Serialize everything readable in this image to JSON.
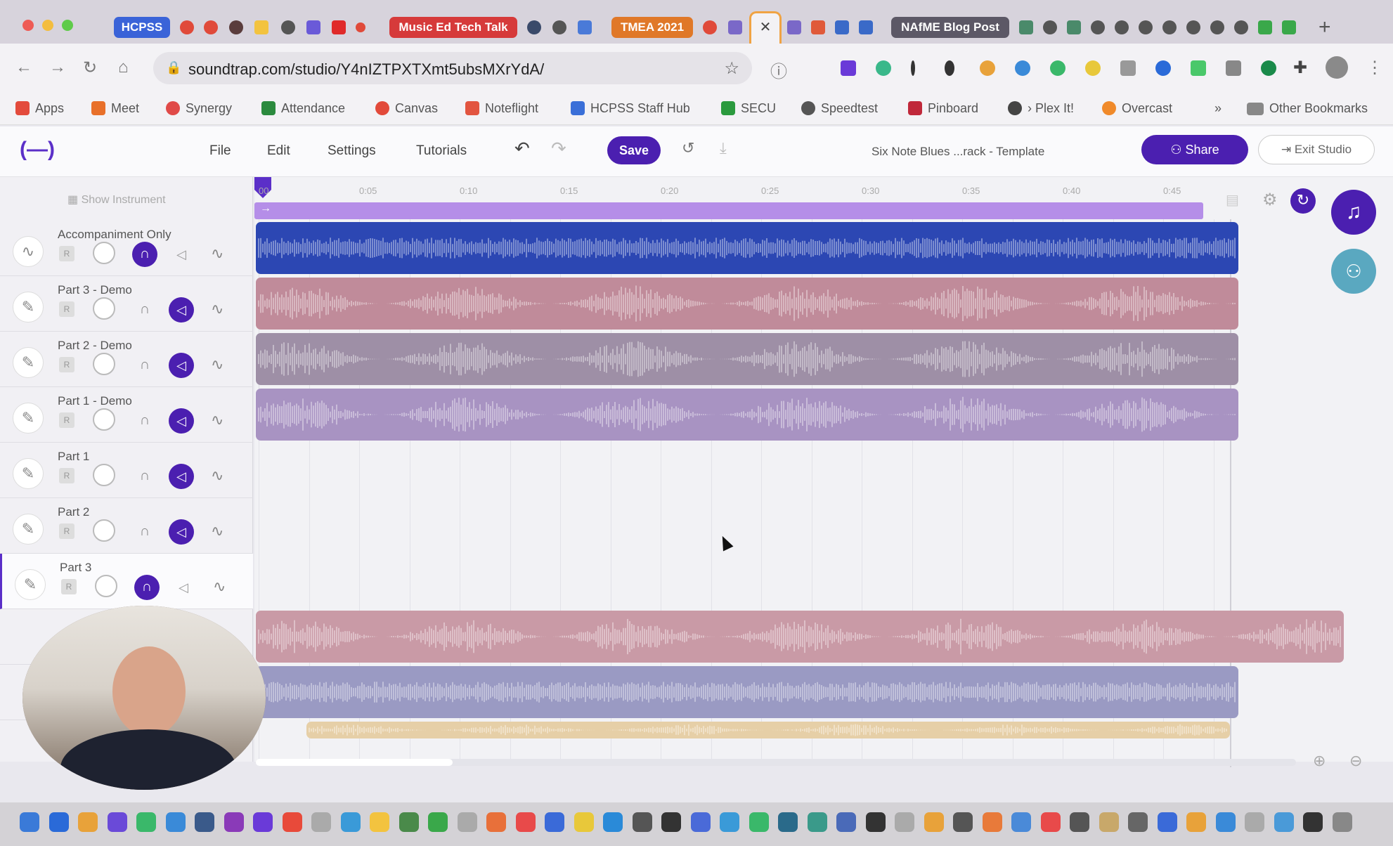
{
  "browser": {
    "tab_groups": [
      {
        "label": "HCPSS",
        "color": "#3a63d8"
      },
      {
        "label": "Music Ed Tech Talk",
        "color": "#d63a3a"
      },
      {
        "label": "TMEA 2021",
        "color": "#e07828"
      },
      {
        "label": "NAfME Blog Post",
        "color": "#5c5866"
      }
    ],
    "active_tab_close": "✕",
    "new_tab": "+",
    "url": "soundtrap.com/studio/Y4nIZTPXTXmt5ubsMXrYdA/"
  },
  "bookmarks": [
    {
      "label": "Apps",
      "color": "#e34b3c"
    },
    {
      "label": "Meet",
      "color": "#e8702a"
    },
    {
      "label": "Synergy",
      "color": "#e04a48"
    },
    {
      "label": "Attendance",
      "color": "#2b8a3e"
    },
    {
      "label": "Canvas",
      "color": "#e24a3a"
    },
    {
      "label": "Noteflight",
      "color": "#e25540"
    },
    {
      "label": "HCPSS Staff Hub",
      "color": "#3a6fd8"
    },
    {
      "label": "SECU",
      "color": "#2b9a3e"
    },
    {
      "label": "Speedtest",
      "color": "#555555"
    },
    {
      "label": "Pinboard",
      "color": "#c0283a"
    },
    {
      "label": "› Plex It!",
      "color": "#444444"
    },
    {
      "label": "Overcast",
      "color": "#f08a2a"
    },
    {
      "label": "»",
      "color": ""
    },
    {
      "label": "Other Bookmarks",
      "color": "#777777"
    }
  ],
  "app": {
    "logo": "(—)",
    "menu": [
      "File",
      "Edit",
      "Settings",
      "Tutorials"
    ],
    "save": "Save",
    "project_title": "Six Note Blues ...rack - Template",
    "share": "Share",
    "exit": "Exit Studio"
  },
  "studio": {
    "show_instrument": "Show Instrument",
    "time_ticks": [
      "00",
      "0:05",
      "0:10",
      "0:15",
      "0:20",
      "0:25",
      "0:30",
      "0:35",
      "0:40",
      "0:45"
    ],
    "tracks": [
      {
        "name": "Accompaniment Only",
        "icon": "waveform-icon",
        "solo_active": true,
        "mute_active": false,
        "clip_color": "#2c47b3",
        "clip": true
      },
      {
        "name": "Part 3 - Demo",
        "icon": "mic-icon",
        "solo_active": false,
        "mute_active": true,
        "clip_color": "#c08b9a",
        "clip": true
      },
      {
        "name": "Part 2 - Demo",
        "icon": "mic-icon",
        "solo_active": false,
        "mute_active": true,
        "clip_color": "#9e8fa6",
        "clip": true
      },
      {
        "name": "Part 1 - Demo",
        "icon": "mic-icon",
        "solo_active": false,
        "mute_active": true,
        "clip_color": "#a893c2",
        "clip": true
      },
      {
        "name": "Part 1",
        "icon": "mic-icon",
        "solo_active": false,
        "mute_active": true,
        "clip": false
      },
      {
        "name": "Part 2",
        "icon": "mic-icon",
        "solo_active": false,
        "mute_active": true,
        "clip": false
      },
      {
        "name": "Part 3",
        "icon": "mic-icon",
        "solo_active": true,
        "mute_active": false,
        "clip": false
      }
    ],
    "extra_clips": [
      {
        "color": "#c99aa6"
      },
      {
        "color": "#9a9ac3"
      },
      {
        "color": "#e6cfa7"
      }
    ]
  },
  "colors": {
    "accent": "#4b1fb0",
    "teal": "#5aa8c0"
  }
}
